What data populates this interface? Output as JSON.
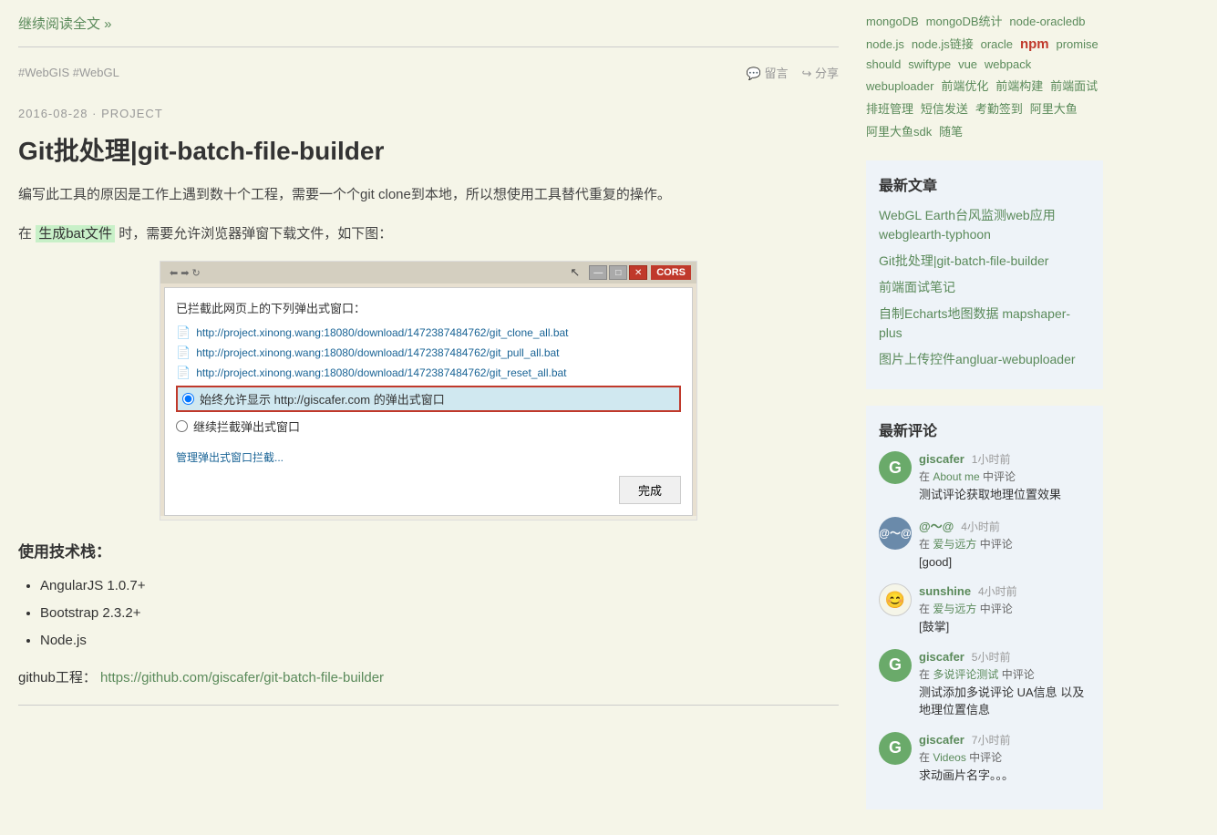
{
  "tags": {
    "items": [
      {
        "label": "mongoDB",
        "class": ""
      },
      {
        "label": "mongoDB统计",
        "class": ""
      },
      {
        "label": "node-oracledb",
        "class": ""
      },
      {
        "label": "node.js",
        "class": ""
      },
      {
        "label": "node.js链接",
        "class": ""
      },
      {
        "label": "oracle",
        "class": ""
      },
      {
        "label": "npm",
        "class": "npm-tag"
      },
      {
        "label": "promise",
        "class": ""
      },
      {
        "label": "should",
        "class": ""
      },
      {
        "label": "swiftype",
        "class": ""
      },
      {
        "label": "vue",
        "class": ""
      },
      {
        "label": "webpack",
        "class": ""
      },
      {
        "label": "webuploader",
        "class": ""
      },
      {
        "label": "前端优化",
        "class": ""
      },
      {
        "label": "前端构建",
        "class": ""
      },
      {
        "label": "前端面试",
        "class": ""
      },
      {
        "label": "排班管理",
        "class": ""
      },
      {
        "label": "短信发送",
        "class": ""
      },
      {
        "label": "考勤签到",
        "class": ""
      },
      {
        "label": "阿里大鱼",
        "class": ""
      },
      {
        "label": "阿里大鱼sdk",
        "class": ""
      },
      {
        "label": "随笔",
        "class": ""
      }
    ]
  },
  "continue_read": "继续阅读全文 »",
  "post_tags_text": "#WebGIS  #WebGL",
  "comment_icon": "💬",
  "comment_label": "留言",
  "share_icon": "↪",
  "share_label": "分享",
  "article": {
    "date": "2016-08-28",
    "separator": "·",
    "category": "PROJECT",
    "title": "Git批处理|git-batch-file-builder",
    "desc1": "编写此工具的原因是工作上遇到数十个工程，需要一个个git clone到本地，所以想使用工具替代重复的操作。",
    "desc2_prefix": "在",
    "highlight": "生成bat文件",
    "desc2_suffix": "时，需要允许浏览器弹窗下载文件，如下图：",
    "popup": {
      "title": "已拦截此网页上的下列弹出式窗口：",
      "downloads": [
        "http://project.xinong.wang:18080/download/1472387484762/git_clone_all.bat",
        "http://project.xinong.wang:18080/download/1472387484762/git_pull_all.bat",
        "http://project.xinong.wang:18080/download/1472387484762/git_reset_all.bat"
      ],
      "radio1": "始终允许显示 http://giscafer.com 的弹出式窗口",
      "radio2": "继续拦截弹出式窗口",
      "manage_link": "管理弹出式窗口拦截...",
      "done_btn": "完成"
    },
    "tech_stack_title": "使用技术栈：",
    "tech_list": [
      "AngularJS 1.0.7+",
      "Bootstrap 2.3.2+",
      "Node.js"
    ],
    "github_prefix": "github工程：",
    "github_url": "https://github.com/giscafer/git-batch-file-builder",
    "github_label": "https://github.com/giscafer/git-batch-file-builder"
  },
  "sidebar": {
    "latest_articles_title": "最新文章",
    "latest_articles": [
      {
        "label": "WebGL Earth台风监测web应用 webglearth-typhoon"
      },
      {
        "label": "Git批处理|git-batch-file-builder"
      },
      {
        "label": "前端面试笔记"
      },
      {
        "label": "自制Echarts地图数据 mapshaper-plus"
      },
      {
        "label": "图片上传控件angluar-webuploader"
      }
    ],
    "latest_comments_title": "最新评论",
    "comments": [
      {
        "author": "giscafer",
        "time": "1小时前",
        "location_prefix": "在",
        "location": "About me",
        "location_suffix": "中评论",
        "text": "测试评论获取地理位置效果",
        "avatar_type": "green",
        "avatar_letter": "G"
      },
      {
        "author": "@～@",
        "time": "4小时前",
        "location_prefix": "在",
        "location": "爱与远方",
        "location_suffix": "中评论",
        "text": "[good]",
        "avatar_type": "blue",
        "avatar_letter": "@"
      },
      {
        "author": "sunshine",
        "time": "4小时前",
        "location_prefix": "在",
        "location": "爱与远方",
        "location_suffix": "中评论",
        "text": "[鼓掌]",
        "avatar_type": "emoji",
        "avatar_letter": "😊"
      },
      {
        "author": "giscafer",
        "time": "5小时前",
        "location_prefix": "在",
        "location": "多说评论测试",
        "location_suffix": "中评论",
        "text": "测试添加多说评论 UA信息 以及地理位置信息",
        "avatar_type": "green",
        "avatar_letter": "G"
      },
      {
        "author": "giscafer",
        "time": "7小时前",
        "location_prefix": "在",
        "location": "Videos",
        "location_suffix": "中评论",
        "text": "求动画片名字。。。",
        "avatar_type": "green",
        "avatar_letter": "G"
      }
    ]
  }
}
